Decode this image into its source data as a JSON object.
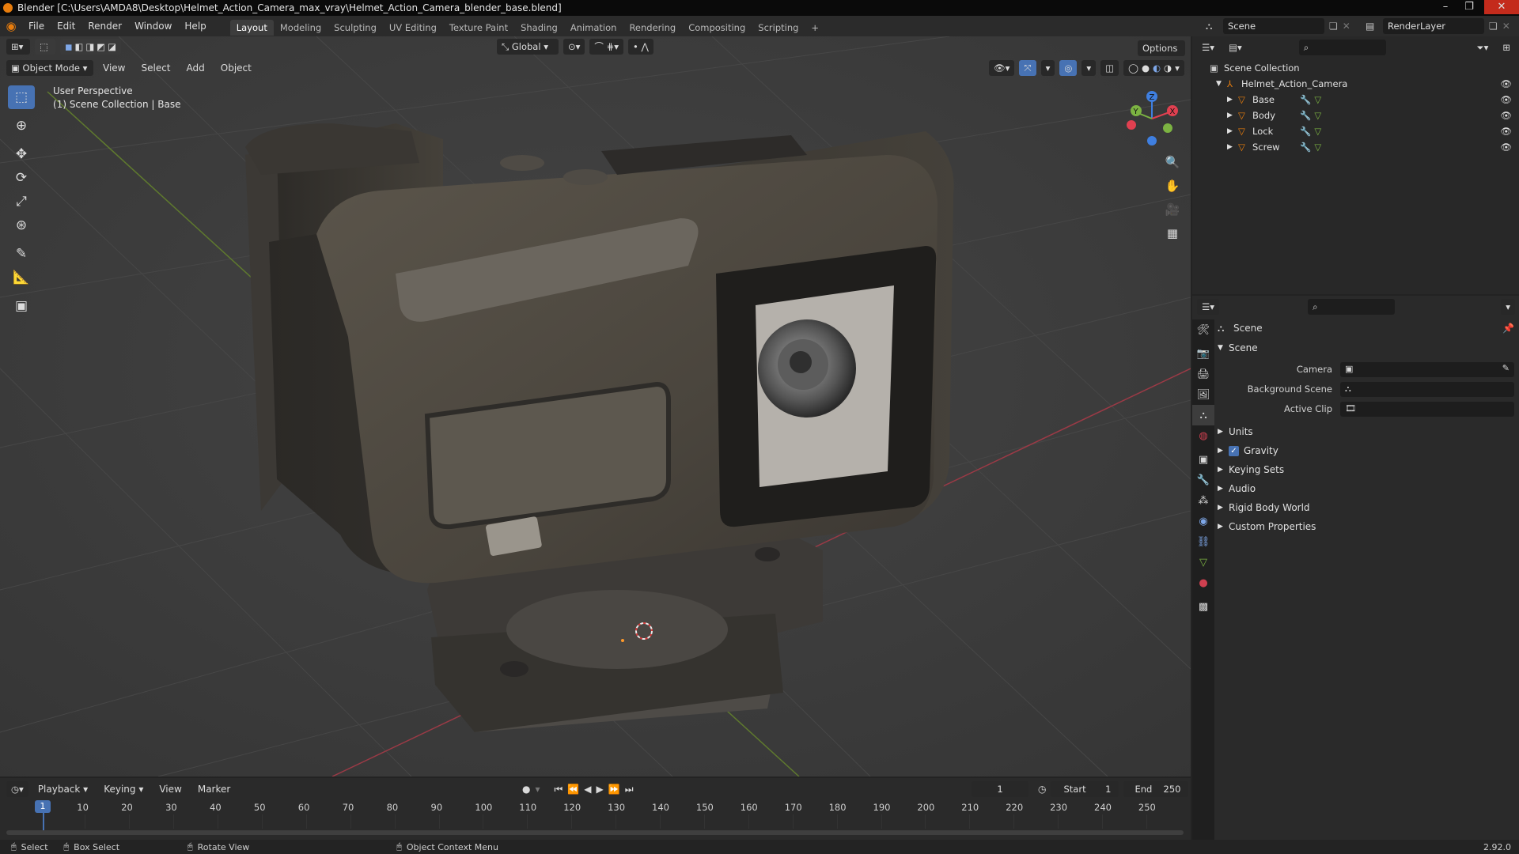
{
  "window": {
    "title": "Blender [C:\\Users\\AMDA8\\Desktop\\Helmet_Action_Camera_max_vray\\Helmet_Action_Camera_blender_base.blend]"
  },
  "menu": [
    "File",
    "Edit",
    "Render",
    "Window",
    "Help"
  ],
  "workspaces": [
    "Layout",
    "Modeling",
    "Sculpting",
    "UV Editing",
    "Texture Paint",
    "Shading",
    "Animation",
    "Rendering",
    "Compositing",
    "Scripting"
  ],
  "active_workspace": "Layout",
  "scene_selector": {
    "value": "Scene"
  },
  "renderlayer_selector": {
    "value": "RenderLayer"
  },
  "viewport": {
    "mode": "Object Mode",
    "menus": [
      "View",
      "Select",
      "Add",
      "Object"
    ],
    "transform_orientation": "Global",
    "options_label": "Options",
    "info_line1": "User Perspective",
    "info_line2": "(1) Scene Collection | Base",
    "gizmo": {
      "x": "X",
      "y": "Y",
      "z": "Z"
    }
  },
  "outliner": {
    "root": "Scene Collection",
    "collection": "Helmet_Action_Camera",
    "objects": [
      "Base",
      "Body",
      "Lock",
      "Screw"
    ]
  },
  "properties": {
    "context": "Scene",
    "panel": "Scene",
    "fields": [
      {
        "label": "Camera"
      },
      {
        "label": "Background Scene"
      },
      {
        "label": "Active Clip"
      }
    ],
    "subpanels": [
      "Units",
      "Gravity",
      "Keying Sets",
      "Audio",
      "Rigid Body World",
      "Custom Properties"
    ],
    "gravity_checked": true
  },
  "timeline": {
    "menus": [
      "Playback",
      "Keying",
      "View",
      "Marker"
    ],
    "current_frame": "1",
    "start_label": "Start",
    "start": "1",
    "end_label": "End",
    "end": "250",
    "ticks": [
      "1",
      "10",
      "20",
      "30",
      "40",
      "50",
      "60",
      "70",
      "80",
      "90",
      "100",
      "110",
      "120",
      "130",
      "140",
      "150",
      "160",
      "170",
      "180",
      "190",
      "200",
      "210",
      "220",
      "230",
      "240",
      "250"
    ]
  },
  "statusbar": {
    "select": "Select",
    "box_select": "Box Select",
    "rotate_view": "Rotate View",
    "context_menu": "Object Context Menu",
    "version": "2.92.0"
  },
  "colors": {
    "accent": "#4772b3",
    "orange": "#e87d0d",
    "x_axis": "#e04050",
    "y_axis": "#7cb342",
    "z_axis": "#3f7fe0"
  }
}
